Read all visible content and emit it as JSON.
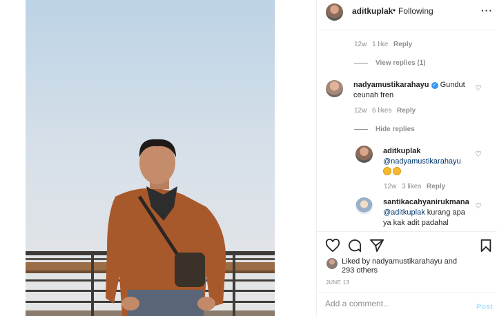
{
  "post": {
    "username": "aditkuplak",
    "separator": "•",
    "follow_status": "Following",
    "more_icon": "more-horizontal-icon"
  },
  "comments": [
    {
      "time": "12w",
      "likes": "1 like",
      "reply_label": "Reply",
      "view_replies": "View replies (1)"
    },
    {
      "username": "nadyamustikarahayu",
      "verified": true,
      "text_line1": "Gundut",
      "text_line2": "ceunah fren",
      "time": "12w",
      "likes": "6 likes",
      "reply_label": "Reply",
      "hide_replies": "Hide replies"
    }
  ],
  "replies": [
    {
      "username": "aditkuplak",
      "mention": "@nadyamustikarahayu",
      "time": "12w",
      "likes": "3 likes",
      "reply_label": "Reply"
    },
    {
      "username": "santikacahyanirukmana",
      "mention": "@aditkuplak",
      "text_after_mention": "kurang apa",
      "text_line2": "ya kak adit padahal"
    }
  ],
  "actions": {
    "like_icon": "heart-icon",
    "comment_icon": "comment-icon",
    "share_icon": "share-icon",
    "save_icon": "bookmark-icon",
    "liked_by_prefix": "Liked by",
    "liked_by_user": "nadyamustikarahayu",
    "liked_by_and": "and",
    "liked_by_others": "293 others",
    "date": "JUNE 13"
  },
  "add_comment": {
    "placeholder": "Add a comment...",
    "post_label": "Post"
  },
  "colors": {
    "link_blue": "#00376b",
    "verified_blue": "#3897f0",
    "post_disabled": "#b2dffc",
    "muted": "#8e8e8e"
  }
}
